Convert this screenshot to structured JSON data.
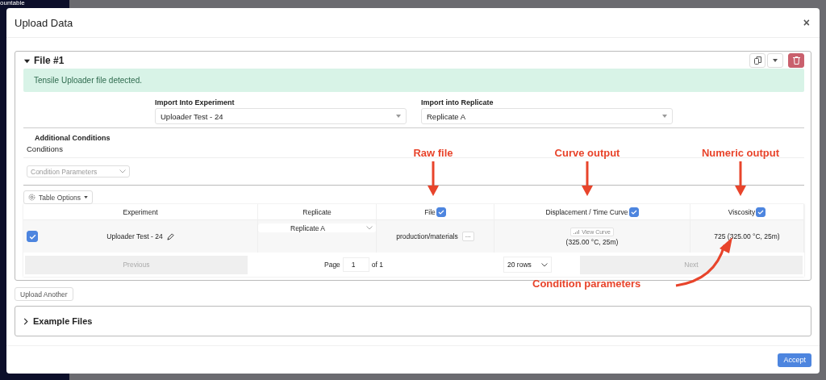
{
  "background": {
    "fragment": "ountable"
  },
  "dialog": {
    "title": "Upload Data",
    "close": "×"
  },
  "file_panel": {
    "title": "File #1",
    "expanded": true,
    "alert": "Tensile Uploader file detected.",
    "experiment_select": {
      "label": "Import Into Experiment",
      "value": "Uploader Test - 24"
    },
    "replicate_select": {
      "label": "Import into Replicate",
      "value": "Replicate A"
    },
    "conditions_heading": "Additional Conditions",
    "conditions_label": "Conditions",
    "condition_select": {
      "placeholder": "Condition Parameters"
    },
    "table_options": "Table Options",
    "table": {
      "columns": [
        {
          "label": "Experiment"
        },
        {
          "label": "Replicate"
        },
        {
          "label": "File",
          "checked": true
        },
        {
          "label": "Displacement / Time Curve",
          "checked": true
        },
        {
          "label": "Viscosity",
          "checked": true
        }
      ],
      "rows": [
        {
          "selected": true,
          "experiment": "Uploader Test - 24",
          "replicate": "Replicate A",
          "file": "production/materials",
          "file_menu": "···",
          "curve_button": "View Curve",
          "curve_conditions": "(325.00 °C, 25m)",
          "viscosity": "725 (325.00 °C, 25m)"
        }
      ]
    },
    "pagination": {
      "previous": "Previous",
      "page_label": "Page",
      "page_value": "1",
      "of": "of 1",
      "rows": "20 rows",
      "next": "Next"
    }
  },
  "upload_another": "Upload Another",
  "example_files": {
    "title": "Example Files",
    "expanded": false
  },
  "accept": "Accept",
  "annotations": [
    {
      "text": "Raw file",
      "kind": "down"
    },
    {
      "text": "Curve output",
      "kind": "down"
    },
    {
      "text": "Numeric output",
      "kind": "down"
    },
    {
      "text": "Condition parameters",
      "kind": "curve"
    }
  ]
}
